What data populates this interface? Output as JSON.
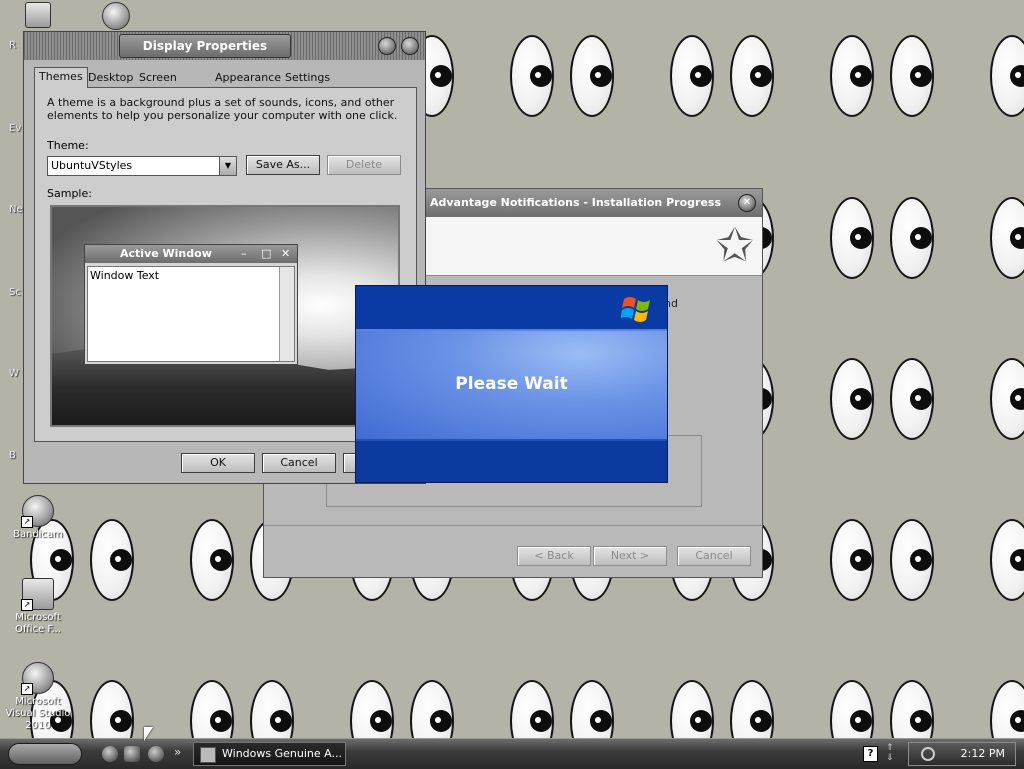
{
  "desktop": {
    "icons": [
      {
        "label": "Bandicam"
      },
      {
        "label": "Microsoft Office F..."
      },
      {
        "label": "Microsoft Visual Studio 2010"
      }
    ],
    "edge_letters": [
      "R",
      "Ev",
      "Ne",
      "Sc",
      "W",
      "B"
    ]
  },
  "display_properties": {
    "title": "Display Properties",
    "tabs": [
      "Themes",
      "Desktop",
      "Screen Saver",
      "Appearance",
      "Settings"
    ],
    "active_tab": "Themes",
    "description": "A theme is a background plus a set of sounds, icons, and other elements to help you personalize your computer with one click.",
    "theme_label": "Theme:",
    "theme_value": "UbuntuVStyles",
    "save_as_label": "Save As...",
    "delete_label": "Delete",
    "sample_label": "Sample:",
    "active_window": {
      "title": "Active Window",
      "minimize": "–",
      "maximize": "□",
      "close": "✕",
      "body_text": "Window Text"
    },
    "ok_label": "OK",
    "cancel_label": "Cancel"
  },
  "installer": {
    "title": "Advantage Notifications - Installation Progress",
    "partial_text": "nd",
    "back_label": "< Back",
    "next_label": "Next >",
    "cancel_label": "Cancel",
    "close_glyph": "✕",
    "header_icon": "star-icon"
  },
  "please_wait": {
    "message": "Please Wait",
    "logo": "windows-flag-icon"
  },
  "taskbar": {
    "task_label": "Windows Genuine A...",
    "overflow_glyph": "»",
    "help_glyph": "?",
    "clock": "2:12 PM"
  },
  "colors": {
    "desktop": "#b3b3a8",
    "dialog_blue": "#0a3aa3",
    "dialog_accent": "#6a93e6"
  }
}
